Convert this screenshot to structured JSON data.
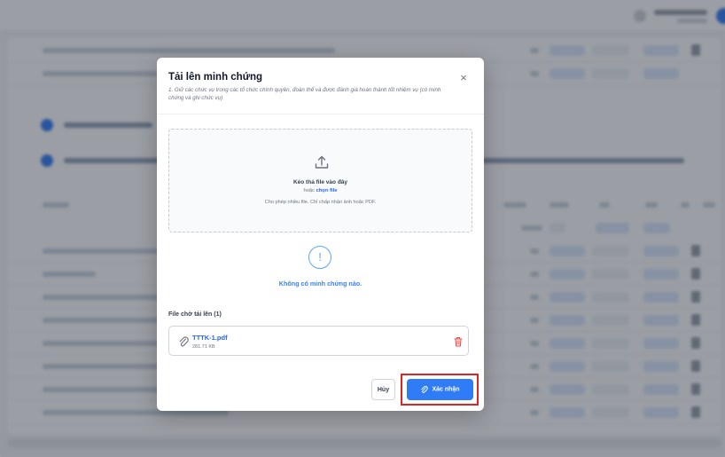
{
  "modal": {
    "title": "Tải lên minh chứng",
    "subtitle": "1. Giữ các chức vụ trong các tổ chức chính quyền, đoàn thể và được đánh giá hoàn thành tốt nhiệm vụ (có minh chứng và ghi chức vụ)",
    "close_icon": "×"
  },
  "dropzone": {
    "icon": "upload-icon",
    "title": "Kéo thả file vào đây",
    "or_text": "hoặc",
    "choose_link": "chọn file",
    "hint": "Cho phép nhiều file. Chỉ chấp nhận ảnh hoặc PDF."
  },
  "evidence": {
    "empty_icon": "!",
    "empty_text": "Không có minh chứng nào."
  },
  "pending": {
    "label": "File chờ tải lên (1)",
    "files": [
      {
        "name": "TTTK-1.pdf",
        "size": "281.71 KB"
      }
    ]
  },
  "footer": {
    "cancel_label": "Hủy",
    "confirm_label": "Xác nhận"
  },
  "colors": {
    "accent": "#2f7cf6",
    "highlight": "#dc2626",
    "danger": "#ef4444"
  }
}
